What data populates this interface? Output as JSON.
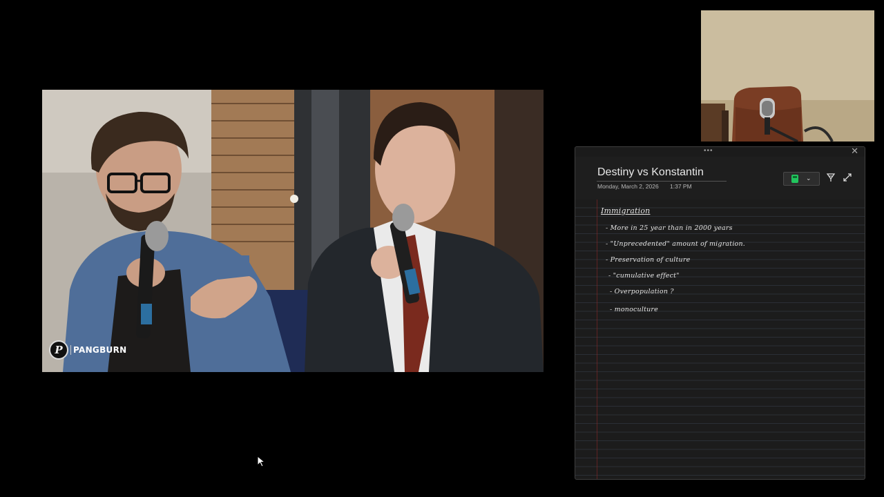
{
  "video": {
    "logo_letter": "P",
    "logo_text": "PANGBURN"
  },
  "notes": {
    "title": "Destiny vs Konstantin",
    "date": "Monday, March 2, 2026",
    "time": "1:37 PM",
    "heading": "Immigration",
    "lines": [
      "- More in 25 year than in 2000 years",
      "- \"Unprecedented\" amount of migration.",
      "- Preservation of culture",
      "- \"cumulative effect\"",
      "- Overpopulation ?",
      "- monoculture"
    ],
    "pen_color": "#22c55e",
    "icons": [
      "drag-handle-icon",
      "close-icon",
      "pen-icon",
      "chevron-down-icon",
      "lasso-icon",
      "expand-icon"
    ]
  },
  "colors": {
    "background": "#000000",
    "panel": "#1c1c1c",
    "margin_line": "#962828"
  }
}
